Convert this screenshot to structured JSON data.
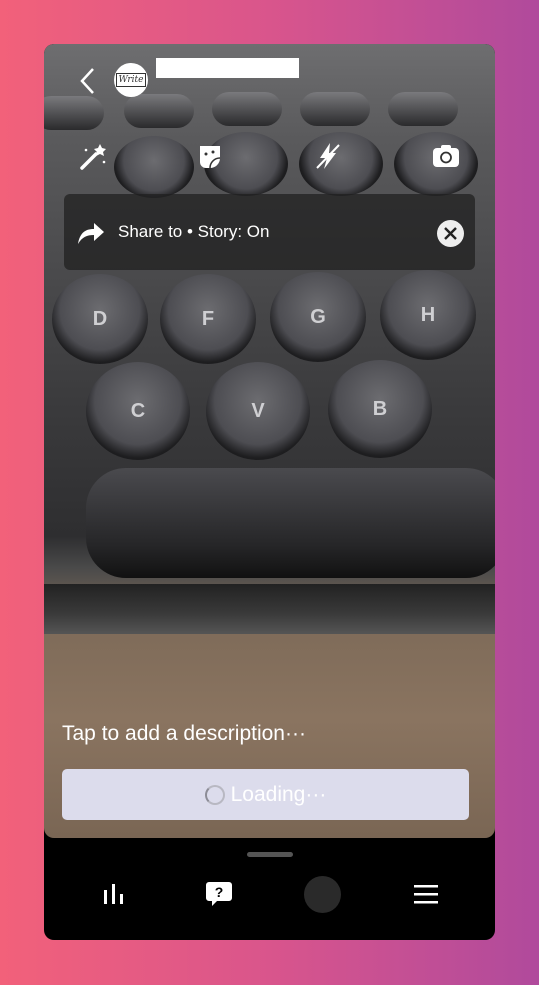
{
  "header": {
    "back_icon": "chevron-left-icon",
    "avatar_text": "Write",
    "name": ""
  },
  "toolbar": {
    "icons": [
      "magic-wand-icon",
      "sticker-icon",
      "flash-off-icon",
      "camera-flip-icon"
    ]
  },
  "photo_keys": {
    "row1": [
      "D",
      "F",
      "G",
      "H"
    ],
    "row2": [
      "C",
      "V",
      "B"
    ]
  },
  "share_banner": {
    "label": "Share to • Story: On",
    "icon": "share-arrow-icon",
    "close_icon": "close-icon"
  },
  "description_placeholder": "Tap to add a description···",
  "loading_button": {
    "label": "Loading···"
  },
  "bottom_nav": {
    "icons": [
      "bar-chart-icon",
      "help-bubble-icon",
      "record-button",
      "menu-icon"
    ]
  }
}
